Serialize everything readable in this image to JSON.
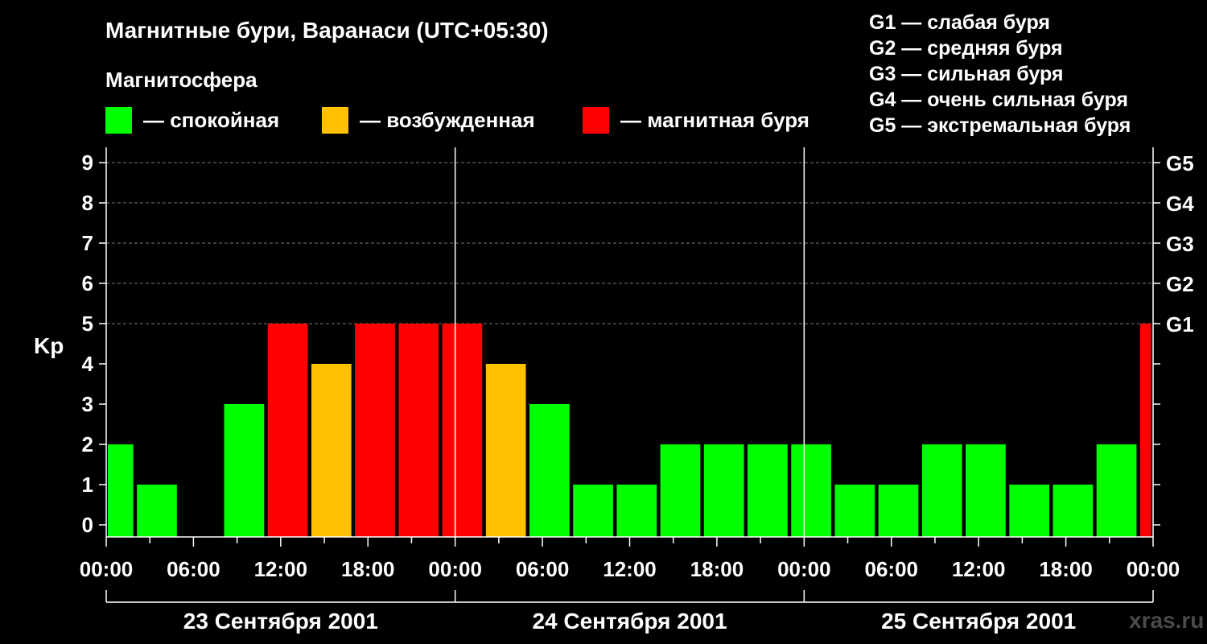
{
  "title": "Магнитные бури, Варанаси (UTC+05:30)",
  "magnetosphere": {
    "title": "Магнитосфера",
    "items": [
      {
        "label": "— спокойная",
        "color": "#00ff00"
      },
      {
        "label": "— возбужденная",
        "color": "#ffc000"
      },
      {
        "label": "— магнитная буря",
        "color": "#ff0000"
      }
    ]
  },
  "storm_legend": [
    "G1 — слабая буря",
    "G2 — средняя буря",
    "G3 — сильная буря",
    "G4 — очень сильная буря",
    "G5 — экстремальная буря"
  ],
  "watermark": "xras.ru",
  "chart_data": {
    "type": "bar",
    "ylabel": "Kp",
    "ylim": [
      0,
      9
    ],
    "yticks": [
      0,
      1,
      2,
      3,
      4,
      5,
      6,
      7,
      8,
      9
    ],
    "right_ticks": [
      {
        "value": 5,
        "label": "G1"
      },
      {
        "value": 6,
        "label": "G2"
      },
      {
        "value": 7,
        "label": "G3"
      },
      {
        "value": 8,
        "label": "G4"
      },
      {
        "value": 9,
        "label": "G5"
      }
    ],
    "xlim_hours": [
      0,
      72
    ],
    "xtick_labels": [
      "00:00",
      "06:00",
      "12:00",
      "18:00",
      "00:00",
      "06:00",
      "12:00",
      "18:00",
      "00:00",
      "06:00",
      "12:00",
      "18:00",
      "00:00"
    ],
    "days": [
      "23 Сентября 2001",
      "24 Сентября 2001",
      "25 Сентября 2001"
    ],
    "grid": "horizontal dashed at 5–9",
    "colors": {
      "quiet": "#00ff00",
      "unsettled": "#ffc000",
      "storm": "#ff0000"
    },
    "bars": [
      {
        "start": 0,
        "end": 1.75,
        "kp": 2,
        "level": "quiet"
      },
      {
        "start": 2.0,
        "end": 4.75,
        "kp": 1,
        "level": "quiet"
      },
      {
        "start": 5.0,
        "end": 7.75,
        "kp": 0,
        "level": "quiet"
      },
      {
        "start": 8.0,
        "end": 10.75,
        "kp": 3,
        "level": "quiet"
      },
      {
        "start": 11.0,
        "end": 13.75,
        "kp": 5,
        "level": "storm"
      },
      {
        "start": 14.0,
        "end": 16.75,
        "kp": 4,
        "level": "unsettled"
      },
      {
        "start": 17.0,
        "end": 19.75,
        "kp": 5,
        "level": "storm"
      },
      {
        "start": 20.0,
        "end": 22.75,
        "kp": 5,
        "level": "storm"
      },
      {
        "start": 23.0,
        "end": 25.75,
        "kp": 5,
        "level": "storm"
      },
      {
        "start": 26.0,
        "end": 28.75,
        "kp": 4,
        "level": "unsettled"
      },
      {
        "start": 29.0,
        "end": 31.75,
        "kp": 3,
        "level": "quiet"
      },
      {
        "start": 32.0,
        "end": 34.75,
        "kp": 1,
        "level": "quiet"
      },
      {
        "start": 35.0,
        "end": 37.75,
        "kp": 1,
        "level": "quiet"
      },
      {
        "start": 38.0,
        "end": 40.75,
        "kp": 2,
        "level": "quiet"
      },
      {
        "start": 41.0,
        "end": 43.75,
        "kp": 2,
        "level": "quiet"
      },
      {
        "start": 44.0,
        "end": 46.75,
        "kp": 2,
        "level": "quiet"
      },
      {
        "start": 47.0,
        "end": 49.75,
        "kp": 2,
        "level": "quiet"
      },
      {
        "start": 50.0,
        "end": 52.75,
        "kp": 1,
        "level": "quiet"
      },
      {
        "start": 53.0,
        "end": 55.75,
        "kp": 1,
        "level": "quiet"
      },
      {
        "start": 56.0,
        "end": 58.75,
        "kp": 2,
        "level": "quiet"
      },
      {
        "start": 59.0,
        "end": 61.75,
        "kp": 2,
        "level": "quiet"
      },
      {
        "start": 62.0,
        "end": 64.75,
        "kp": 1,
        "level": "quiet"
      },
      {
        "start": 65.0,
        "end": 67.75,
        "kp": 1,
        "level": "quiet"
      },
      {
        "start": 68.0,
        "end": 70.75,
        "kp": 2,
        "level": "quiet"
      },
      {
        "start": 71.0,
        "end": 71.75,
        "kp": 5,
        "level": "storm"
      }
    ]
  }
}
